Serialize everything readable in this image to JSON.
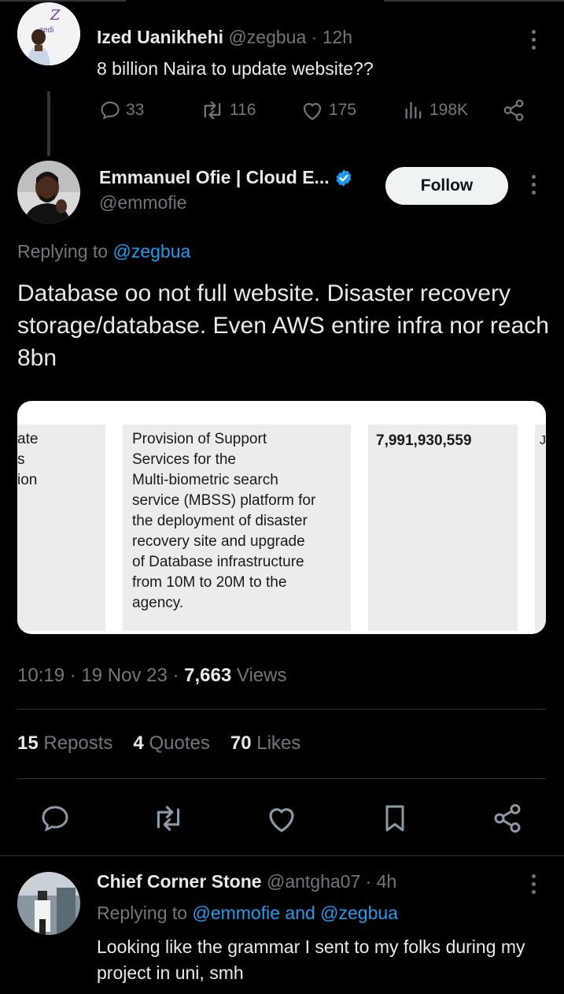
{
  "parent_tweet": {
    "author_name": "Ized Uanikhehi",
    "handle": "@zegbua",
    "separator": "·",
    "time": "12h",
    "text": "8 billion Naira to update website??",
    "replies": "33",
    "reposts": "116",
    "likes": "175",
    "views": "198K",
    "avatar_logo_text": "zedi"
  },
  "main_tweet": {
    "author_name": "Emmanuel Ofie | Cloud E...",
    "handle": "@emmofie",
    "follow_label": "Follow",
    "replying_prefix": "Replying to",
    "replying_to": "@zegbua",
    "text": "Database oo not full website. Disaster recovery storage/database. Even AWS entire infra nor reach 8bn",
    "image": {
      "left_fragment_lines": [
        "ate",
        "s",
        "ion"
      ],
      "description_lines": [
        "Provision of Support",
        "Services for the",
        "Multi-biometric search",
        "service (MBSS) platform for",
        "the deployment of disaster",
        "recovery site and upgrade",
        "of Database infrastructure",
        "from 10M to 20M to the",
        "agency."
      ],
      "amount": "7,991,930,559",
      "right_fragment": "J"
    },
    "time": "10:19",
    "date": "19 Nov 23",
    "dot": "·",
    "views_count": "7,663",
    "views_label": "Views",
    "reposts_count": "15",
    "reposts_label": "Reposts",
    "quotes_count": "4",
    "quotes_label": "Quotes",
    "likes_count": "70",
    "likes_label": "Likes"
  },
  "reply_tweet": {
    "author_name": "Chief Corner Stone",
    "handle": "@antgha07",
    "separator": "·",
    "time": "4h",
    "replying_prefix": "Replying to",
    "replying_to": "@emmofie and @zegbua",
    "text": "Looking like the grammar I sent to my folks during my project in uni, smh"
  },
  "colors": {
    "background": "#000000",
    "text": "#e7e9ea",
    "muted": "#71767b",
    "link": "#1d9bf0",
    "verified": "#1d9bf0",
    "divider": "#2f3336"
  },
  "icons": [
    "reply-icon",
    "repost-icon",
    "like-icon",
    "views-icon",
    "share-icon",
    "bookmark-icon",
    "more-icon",
    "verified-badge-icon"
  ]
}
